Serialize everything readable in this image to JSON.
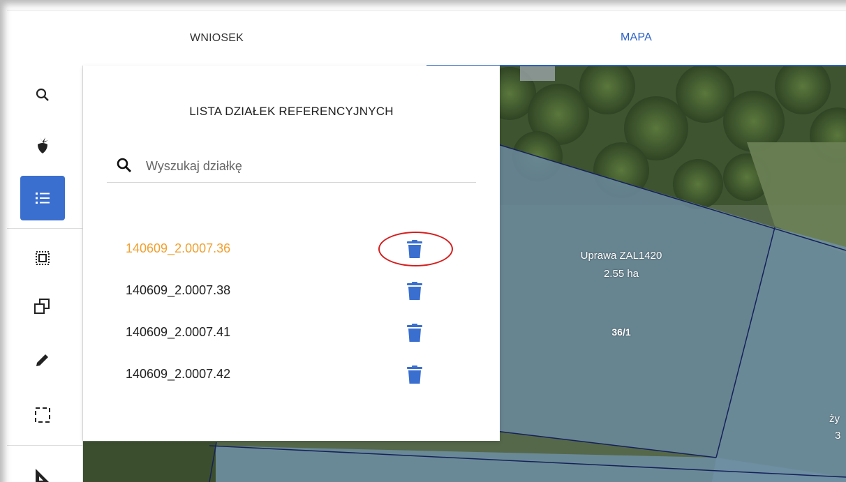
{
  "tabs": [
    {
      "label": "WNIOSEK",
      "active": false
    },
    {
      "label": "MAPA",
      "active": true
    }
  ],
  "toolbar": {
    "tools": [
      {
        "icon": "search-icon",
        "active": false
      },
      {
        "icon": "crop-beet-icon",
        "active": false
      },
      {
        "icon": "list-icon",
        "active": true
      },
      {
        "icon": "select-area-icon",
        "active": false
      },
      {
        "icon": "copy-shape-icon",
        "active": false
      },
      {
        "icon": "edit-pencil-icon",
        "active": false
      },
      {
        "icon": "dashed-rectangle-icon",
        "active": false
      },
      {
        "icon": "measure-ruler-icon",
        "active": false
      }
    ]
  },
  "panel": {
    "title": "LISTA DZIAŁEK REFERENCYJNYCH",
    "search_placeholder": "Wyszukaj działkę",
    "parcels": [
      {
        "id": "140609_2.0007.36",
        "selected": true
      },
      {
        "id": "140609_2.0007.38",
        "selected": false
      },
      {
        "id": "140609_2.0007.41",
        "selected": false
      },
      {
        "id": "140609_2.0007.42",
        "selected": false
      }
    ]
  },
  "map": {
    "crop_label": "Uprawa ZAL1420",
    "crop_area": "2.55 ha",
    "parcel_number": "36/1",
    "edge_label_1": "ży",
    "edge_label_2": "3"
  },
  "colors": {
    "accent": "#2b62c4",
    "selected_parcel": "#f0a030",
    "highlight_ring": "#d41f1f",
    "delete_icon": "#3a6fd0"
  }
}
